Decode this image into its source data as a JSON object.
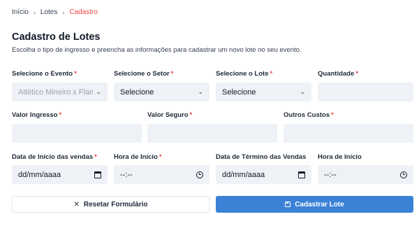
{
  "breadcrumb": {
    "home": "Início",
    "lotes": "Lotes",
    "current": "Cadastro"
  },
  "header": {
    "title": "Cadastro de Lotes",
    "subtitle": "Escolha o tipo de ingresso e preencha as informações para cadastrar um novo lote no seu evento."
  },
  "fields": {
    "evento": {
      "label": "Selecione o Evento",
      "value": "Atlético Mineiro x Flamengo",
      "required": "*"
    },
    "setor": {
      "label": "Selecione o Setor",
      "value": "Selecione",
      "required": "*"
    },
    "lote": {
      "label": "Selecione o Lote",
      "value": "Selecione",
      "required": "*"
    },
    "quantidade": {
      "label": "Quantidade",
      "value": "",
      "required": "*"
    },
    "valor_ingresso": {
      "label": "Valor Ingresso",
      "value": "",
      "required": "*"
    },
    "valor_seguro": {
      "label": "Valor Seguro",
      "value": "",
      "required": "*"
    },
    "outros_custos": {
      "label": "Outros Custos",
      "value": "",
      "required": "*"
    },
    "data_inicio": {
      "label": "Data de Início das vendas",
      "placeholder": "dd/mm/aaaa",
      "required": "*"
    },
    "hora_inicio": {
      "label": "Hora de Início",
      "placeholder": "--:--",
      "required": "*"
    },
    "data_termino": {
      "label": "Data de Término das Vendas",
      "placeholder": "dd/mm/aaaa"
    },
    "hora_inicio_2": {
      "label": "Hora de Início",
      "placeholder": "--:--"
    }
  },
  "actions": {
    "reset_label": "Resetar Formulário",
    "submit_label": "Cadastrar Lote"
  },
  "colors": {
    "accent": "#3b82d6",
    "required": "#ef4444",
    "field_bg": "#eef2f6"
  }
}
